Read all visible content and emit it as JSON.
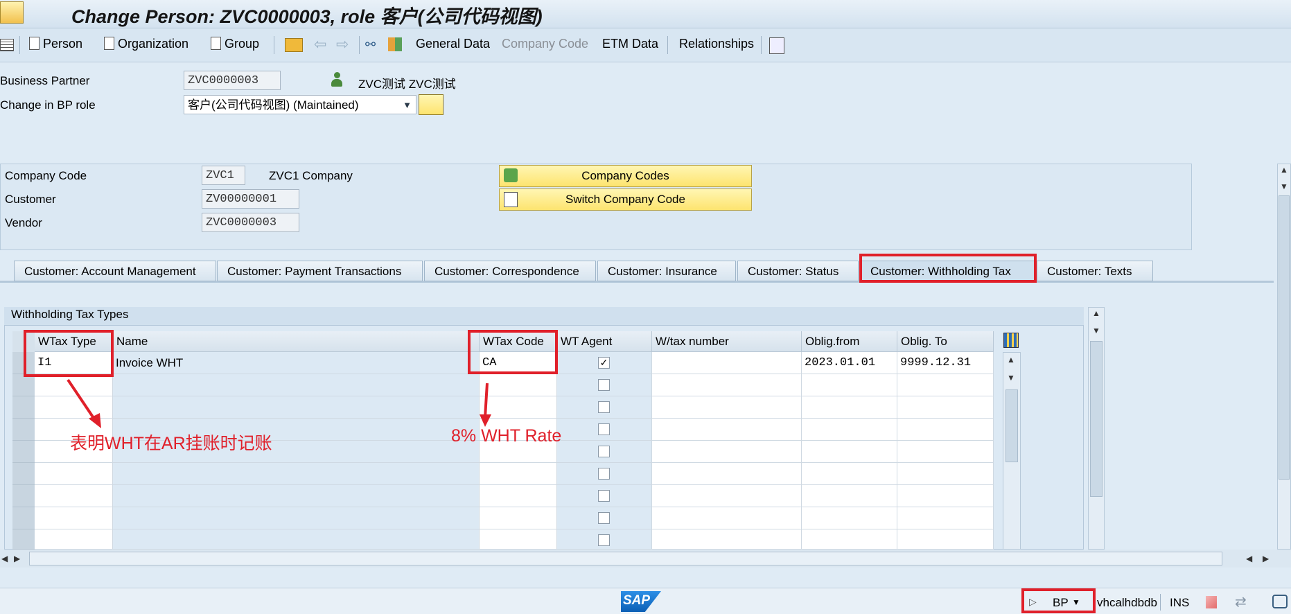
{
  "window": {
    "title": "Change Person: ZVC0000003, role 客户(公司代码视图)"
  },
  "toolbar": {
    "person": "Person",
    "organization": "Organization",
    "group": "Group",
    "general_data": "General Data",
    "company_code": "Company Code",
    "etm_data": "ETM Data",
    "relationships": "Relationships"
  },
  "header": {
    "bp_label": "Business Partner",
    "bp_value": "ZVC0000003",
    "bp_name": "ZVC测试 ZVC测试",
    "role_label": "Change in BP role",
    "role_value": "客户(公司代码视图) (Maintained)"
  },
  "company": {
    "cc_label": "Company Code",
    "cc_value": "ZVC1",
    "cc_name": "ZVC1 Company",
    "customer_label": "Customer",
    "customer_value": "ZV00000001",
    "vendor_label": "Vendor",
    "vendor_value": "ZVC0000003",
    "btn_company_codes": "Company Codes",
    "btn_switch": "Switch Company Code"
  },
  "tabs": [
    "Customer: Account Management",
    "Customer: Payment Transactions",
    "Customer: Correspondence",
    "Customer: Insurance",
    "Customer: Status",
    "Customer: Withholding Tax",
    "Customer: Texts"
  ],
  "withholding": {
    "group_title": "Withholding Tax Types",
    "columns": [
      "WTax Type",
      "Name",
      "WTax Code",
      "WT Agent",
      "W/tax number",
      "Oblig.from",
      "Oblig. To"
    ],
    "row": {
      "type": "I1",
      "name": "Invoice WHT",
      "code": "CA",
      "agent": "✓",
      "oblig_from": "2023.01.01",
      "oblig_to": "9999.12.31"
    }
  },
  "annotations": {
    "left": "表明WHT在AR挂账时记账",
    "right": "8% WHT Rate"
  },
  "status": {
    "logo": "SAP",
    "tcode": "BP",
    "server": "vhcalhdbdb",
    "mode": "INS"
  },
  "colors": {
    "highlight": "#e0202a",
    "button": "#fde46f"
  }
}
